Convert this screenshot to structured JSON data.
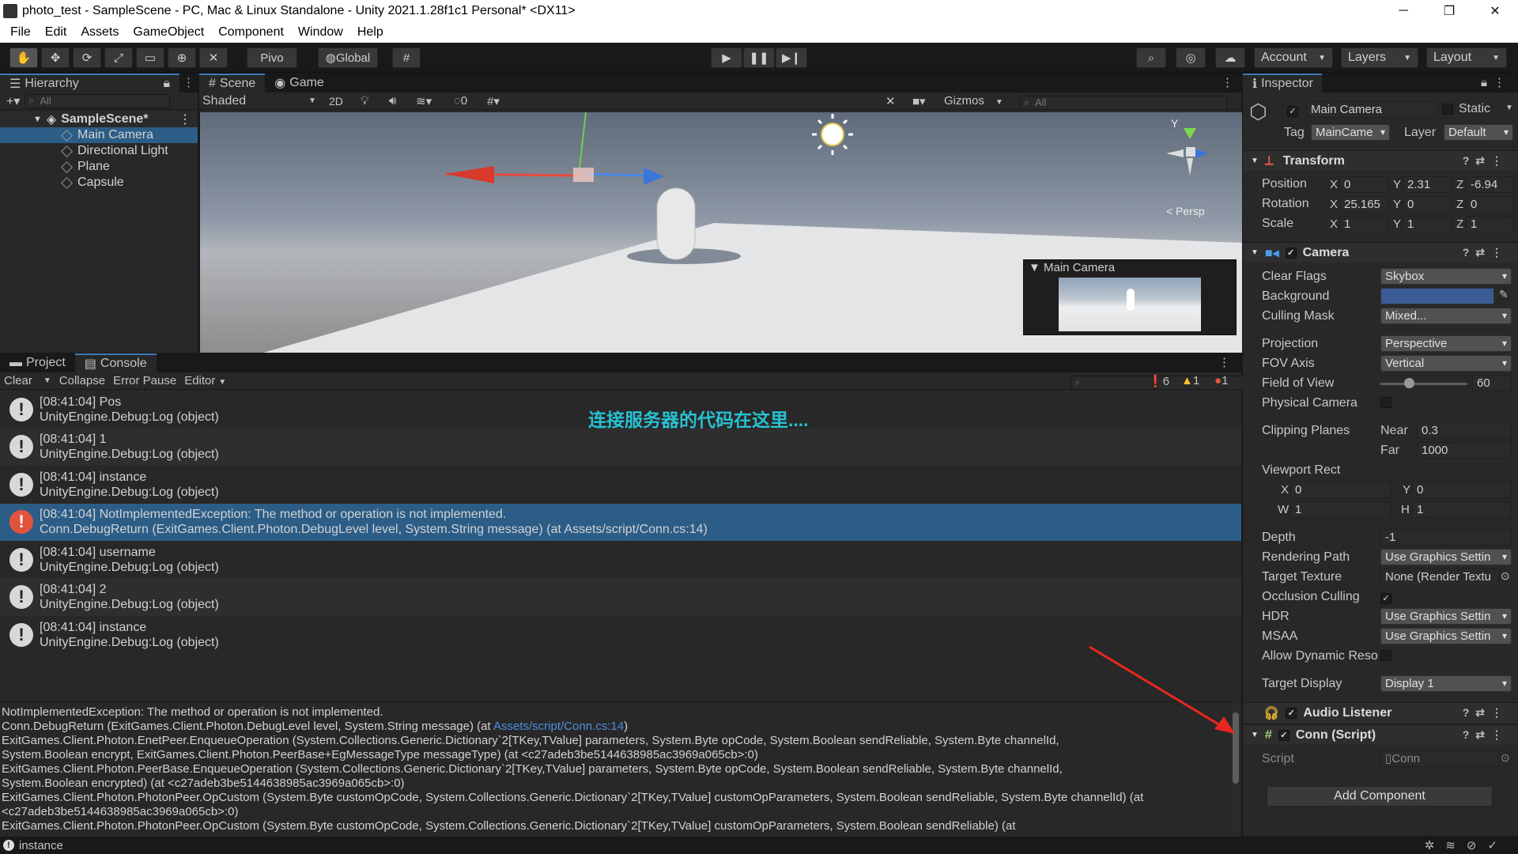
{
  "window": {
    "title": "photo_test - SampleScene - PC, Mac & Linux Standalone - Unity 2021.1.28f1c1 Personal* <DX11>",
    "minimize": "─",
    "maximize": "❐",
    "close": "✕"
  },
  "menu": [
    "File",
    "Edit",
    "Assets",
    "GameObject",
    "Component",
    "Window",
    "Help"
  ],
  "toolbar": {
    "pivot": "Pivo",
    "global": "Global",
    "account": "Account",
    "layers": "Layers",
    "layout": "Layout"
  },
  "hierarchy": {
    "tab": "Hierarchy",
    "search": "All",
    "scene": "SampleScene*",
    "items": [
      "Main Camera",
      "Directional Light",
      "Plane",
      "Capsule"
    ]
  },
  "scene": {
    "tab_scene": "Scene",
    "tab_game": "Game",
    "shading": "Shaded",
    "mode2d": "2D",
    "hidden_count": "0",
    "gizmos": "Gizmos",
    "search": "All",
    "persp": "< Persp",
    "preview_title": "Main Camera"
  },
  "console": {
    "tab_project": "Project",
    "tab_console": "Console",
    "clear": "Clear",
    "collapse": "Collapse",
    "error_pause": "Error Pause",
    "editor": "Editor",
    "log_count": "6",
    "warn_count": "1",
    "err_count": "1",
    "overlay": "连接服务器的代码在这里....",
    "entries": [
      {
        "line1": "[08:41:04] Pos",
        "line2": "UnityEngine.Debug:Log (object)",
        "type": "log"
      },
      {
        "line1": "[08:41:04] 1",
        "line2": "UnityEngine.Debug:Log (object)",
        "type": "log"
      },
      {
        "line1": "[08:41:04] instance",
        "line2": "UnityEngine.Debug:Log (object)",
        "type": "log"
      },
      {
        "line1": "[08:41:04] NotImplementedException: The method or operation is not implemented.",
        "line2": "Conn.DebugReturn (ExitGames.Client.Photon.DebugLevel level, System.String message) (at Assets/script/Conn.cs:14)",
        "type": "error"
      },
      {
        "line1": "[08:41:04] username",
        "line2": "UnityEngine.Debug:Log (object)",
        "type": "log"
      },
      {
        "line1": "[08:41:04] 2",
        "line2": "UnityEngine.Debug:Log (object)",
        "type": "log"
      },
      {
        "line1": "[08:41:04] instance",
        "line2": "UnityEngine.Debug:Log (object)",
        "type": "log"
      }
    ],
    "trace_1": "NotImplementedException: The method or operation is not implemented.",
    "trace_2_pre": "Conn.DebugReturn (ExitGames.Client.Photon.DebugLevel level, System.String message) (at ",
    "trace_2_link": "Assets/script/Conn.cs:14",
    "trace_2_post": ")",
    "trace_rest": [
      "ExitGames.Client.Photon.EnetPeer.EnqueueOperation (System.Collections.Generic.Dictionary`2[TKey,TValue] parameters, System.Byte opCode, System.Boolean sendReliable, System.Byte channelId,",
      "System.Boolean encrypt, ExitGames.Client.Photon.PeerBase+EgMessageType messageType) (at <c27adeb3be5144638985ac3969a065cb>:0)",
      "ExitGames.Client.Photon.PeerBase.EnqueueOperation (System.Collections.Generic.Dictionary`2[TKey,TValue] parameters, System.Byte opCode, System.Boolean sendReliable, System.Byte channelId,",
      "System.Boolean encrypted) (at <c27adeb3be5144638985ac3969a065cb>:0)",
      "ExitGames.Client.Photon.PhotonPeer.OpCustom (System.Byte customOpCode, System.Collections.Generic.Dictionary`2[TKey,TValue] customOpParameters, System.Boolean sendReliable, System.Byte channelId) (at",
      "<c27adeb3be5144638985ac3969a065cb>:0)",
      "ExitGames.Client.Photon.PhotonPeer.OpCustom (System.Byte customOpCode, System.Collections.Generic.Dictionary`2[TKey,TValue] customOpParameters, System.Boolean sendReliable) (at"
    ]
  },
  "status": {
    "text": "instance"
  },
  "inspector": {
    "tab": "Inspector",
    "object_name": "Main Camera",
    "static": "Static",
    "tag_label": "Tag",
    "tag": "MainCame",
    "layer_label": "Layer",
    "layer": "Default",
    "transform": {
      "title": "Transform",
      "position": "Position",
      "rotation": "Rotation",
      "scale": "Scale",
      "px": "0",
      "py": "2.31",
      "pz": "-6.94",
      "rx": "25.165",
      "ry": "0",
      "rz": "0",
      "sx": "1",
      "sy": "1",
      "sz": "1"
    },
    "camera": {
      "title": "Camera",
      "clear_flags": "Clear Flags",
      "clear_flags_val": "Skybox",
      "background": "Background",
      "background_color": "#3b5b94",
      "culling_mask": "Culling Mask",
      "culling_mask_val": "Mixed...",
      "projection": "Projection",
      "projection_val": "Perspective",
      "fov_axis": "FOV Axis",
      "fov_axis_val": "Vertical",
      "fov": "Field of View",
      "fov_val": "60",
      "fov_fraction": 0.33,
      "physical": "Physical Camera",
      "clipping": "Clipping Planes",
      "near": "Near",
      "near_val": "0.3",
      "far": "Far",
      "far_val": "1000",
      "viewport": "Viewport Rect",
      "vx": "0",
      "vy": "0",
      "vw": "1",
      "vh": "1",
      "depth": "Depth",
      "depth_val": "-1",
      "rendering_path": "Rendering Path",
      "rendering_path_val": "Use Graphics Settin",
      "target_texture": "Target Texture",
      "target_texture_val": "None (Render Textu",
      "occlusion": "Occlusion Culling",
      "hdr": "HDR",
      "hdr_val": "Use Graphics Settin",
      "msaa": "MSAA",
      "msaa_val": "Use Graphics Settin",
      "dynamic": "Allow Dynamic Reso",
      "target_display": "Target Display",
      "target_display_val": "Display 1"
    },
    "audio": {
      "title": "Audio Listener"
    },
    "conn": {
      "title": "Conn (Script)",
      "script_label": "Script",
      "script_val": "Conn"
    },
    "add_component": "Add Component",
    "x": "X",
    "y": "Y",
    "z": "Z",
    "w": "W",
    "h": "H"
  }
}
